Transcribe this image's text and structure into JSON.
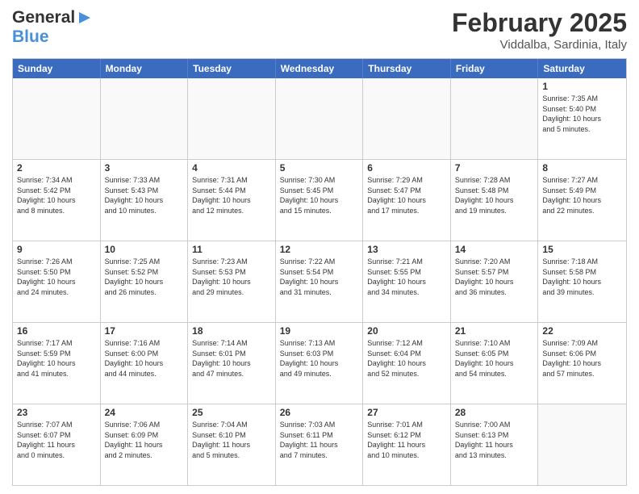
{
  "header": {
    "logo_line1": "General",
    "logo_line2": "Blue",
    "month": "February 2025",
    "location": "Viddalba, Sardinia, Italy"
  },
  "days": [
    "Sunday",
    "Monday",
    "Tuesday",
    "Wednesday",
    "Thursday",
    "Friday",
    "Saturday"
  ],
  "rows": [
    [
      {
        "day": "",
        "info": ""
      },
      {
        "day": "",
        "info": ""
      },
      {
        "day": "",
        "info": ""
      },
      {
        "day": "",
        "info": ""
      },
      {
        "day": "",
        "info": ""
      },
      {
        "day": "",
        "info": ""
      },
      {
        "day": "1",
        "info": "Sunrise: 7:35 AM\nSunset: 5:40 PM\nDaylight: 10 hours\nand 5 minutes."
      }
    ],
    [
      {
        "day": "2",
        "info": "Sunrise: 7:34 AM\nSunset: 5:42 PM\nDaylight: 10 hours\nand 8 minutes."
      },
      {
        "day": "3",
        "info": "Sunrise: 7:33 AM\nSunset: 5:43 PM\nDaylight: 10 hours\nand 10 minutes."
      },
      {
        "day": "4",
        "info": "Sunrise: 7:31 AM\nSunset: 5:44 PM\nDaylight: 10 hours\nand 12 minutes."
      },
      {
        "day": "5",
        "info": "Sunrise: 7:30 AM\nSunset: 5:45 PM\nDaylight: 10 hours\nand 15 minutes."
      },
      {
        "day": "6",
        "info": "Sunrise: 7:29 AM\nSunset: 5:47 PM\nDaylight: 10 hours\nand 17 minutes."
      },
      {
        "day": "7",
        "info": "Sunrise: 7:28 AM\nSunset: 5:48 PM\nDaylight: 10 hours\nand 19 minutes."
      },
      {
        "day": "8",
        "info": "Sunrise: 7:27 AM\nSunset: 5:49 PM\nDaylight: 10 hours\nand 22 minutes."
      }
    ],
    [
      {
        "day": "9",
        "info": "Sunrise: 7:26 AM\nSunset: 5:50 PM\nDaylight: 10 hours\nand 24 minutes."
      },
      {
        "day": "10",
        "info": "Sunrise: 7:25 AM\nSunset: 5:52 PM\nDaylight: 10 hours\nand 26 minutes."
      },
      {
        "day": "11",
        "info": "Sunrise: 7:23 AM\nSunset: 5:53 PM\nDaylight: 10 hours\nand 29 minutes."
      },
      {
        "day": "12",
        "info": "Sunrise: 7:22 AM\nSunset: 5:54 PM\nDaylight: 10 hours\nand 31 minutes."
      },
      {
        "day": "13",
        "info": "Sunrise: 7:21 AM\nSunset: 5:55 PM\nDaylight: 10 hours\nand 34 minutes."
      },
      {
        "day": "14",
        "info": "Sunrise: 7:20 AM\nSunset: 5:57 PM\nDaylight: 10 hours\nand 36 minutes."
      },
      {
        "day": "15",
        "info": "Sunrise: 7:18 AM\nSunset: 5:58 PM\nDaylight: 10 hours\nand 39 minutes."
      }
    ],
    [
      {
        "day": "16",
        "info": "Sunrise: 7:17 AM\nSunset: 5:59 PM\nDaylight: 10 hours\nand 41 minutes."
      },
      {
        "day": "17",
        "info": "Sunrise: 7:16 AM\nSunset: 6:00 PM\nDaylight: 10 hours\nand 44 minutes."
      },
      {
        "day": "18",
        "info": "Sunrise: 7:14 AM\nSunset: 6:01 PM\nDaylight: 10 hours\nand 47 minutes."
      },
      {
        "day": "19",
        "info": "Sunrise: 7:13 AM\nSunset: 6:03 PM\nDaylight: 10 hours\nand 49 minutes."
      },
      {
        "day": "20",
        "info": "Sunrise: 7:12 AM\nSunset: 6:04 PM\nDaylight: 10 hours\nand 52 minutes."
      },
      {
        "day": "21",
        "info": "Sunrise: 7:10 AM\nSunset: 6:05 PM\nDaylight: 10 hours\nand 54 minutes."
      },
      {
        "day": "22",
        "info": "Sunrise: 7:09 AM\nSunset: 6:06 PM\nDaylight: 10 hours\nand 57 minutes."
      }
    ],
    [
      {
        "day": "23",
        "info": "Sunrise: 7:07 AM\nSunset: 6:07 PM\nDaylight: 11 hours\nand 0 minutes."
      },
      {
        "day": "24",
        "info": "Sunrise: 7:06 AM\nSunset: 6:09 PM\nDaylight: 11 hours\nand 2 minutes."
      },
      {
        "day": "25",
        "info": "Sunrise: 7:04 AM\nSunset: 6:10 PM\nDaylight: 11 hours\nand 5 minutes."
      },
      {
        "day": "26",
        "info": "Sunrise: 7:03 AM\nSunset: 6:11 PM\nDaylight: 11 hours\nand 7 minutes."
      },
      {
        "day": "27",
        "info": "Sunrise: 7:01 AM\nSunset: 6:12 PM\nDaylight: 11 hours\nand 10 minutes."
      },
      {
        "day": "28",
        "info": "Sunrise: 7:00 AM\nSunset: 6:13 PM\nDaylight: 11 hours\nand 13 minutes."
      },
      {
        "day": "",
        "info": ""
      }
    ]
  ]
}
